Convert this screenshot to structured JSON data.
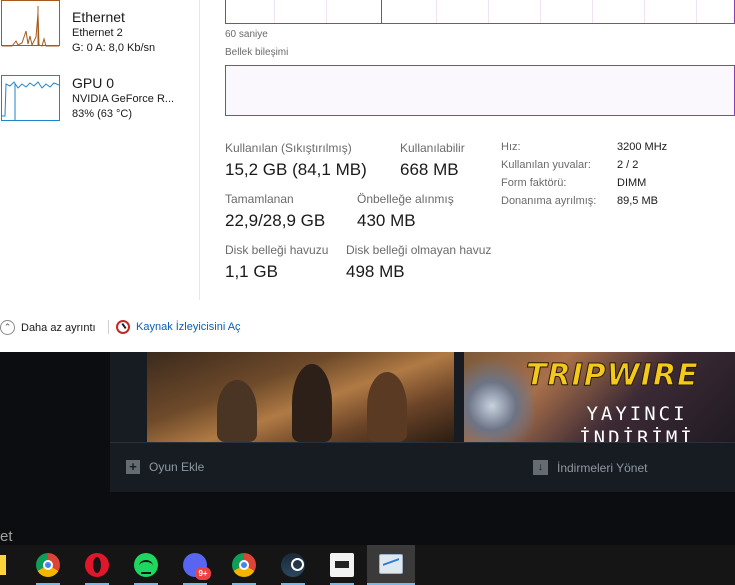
{
  "sidebar": {
    "ethernet": {
      "title": "Ethernet",
      "name": "Ethernet 2",
      "rate": "G: 0 A: 8,0 Kb/sn",
      "graph_color": "#a75a1b"
    },
    "gpu": {
      "title": "GPU 0",
      "name": "NVIDIA GeForce R...",
      "usage": "83% (63 °C)",
      "graph_color": "#1e86c8"
    }
  },
  "memory": {
    "graph_caption": "60 saniye",
    "composition_label": "Bellek bileşimi",
    "accent_color": "#8b3fb8",
    "stats": {
      "in_use_label": "Kullanılan (Sıkıştırılmış)",
      "in_use_value": "15,2 GB (84,1 MB)",
      "available_label": "Kullanılabilir",
      "available_value": "668 MB",
      "committed_label": "Tamamlanan",
      "committed_value": "22,9/28,9 GB",
      "cached_label": "Önbelleğe alınmış",
      "cached_value": "430 MB",
      "paged_pool_label": "Disk belleği havuzu",
      "paged_pool_value": "1,1 GB",
      "nonpaged_pool_label": "Disk belleği olmayan havuz",
      "nonpaged_pool_value": "498 MB"
    },
    "details": {
      "speed_label": "Hız:",
      "speed_value": "3200 MHz",
      "slots_label": "Kullanılan yuvalar:",
      "slots_value": "2 / 2",
      "form_label": "Form faktörü:",
      "form_value": "DIMM",
      "reserved_label": "Donanıma ayrılmış:",
      "reserved_value": "89,5 MB"
    }
  },
  "footer": {
    "fewer_details": "Daha az ayrıntı",
    "resource_monitor": "Kaynak İzleyicisini Aç"
  },
  "steam": {
    "promo_title": "TRIPWIRE",
    "promo_subtitle": "YAYINCI İNDİRİMİ",
    "add_game": "Oyun Ekle",
    "manage_downloads": "İndirmeleri Yönet",
    "stray_char": "et"
  },
  "taskbar": {
    "icons": [
      "chrome-icon",
      "opera-icon",
      "spotify-icon",
      "discord-icon",
      "chrome-icon",
      "steam-icon",
      "pubg-icon",
      "task-manager-icon"
    ],
    "discord_badge": "9+"
  }
}
